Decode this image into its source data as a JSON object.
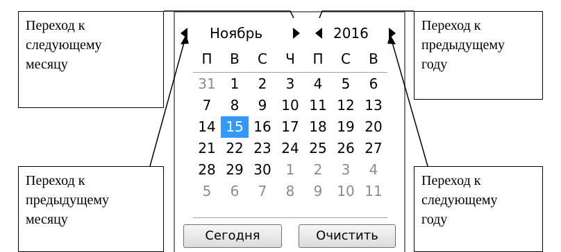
{
  "callouts": {
    "top_left": {
      "lines": [
        "Переход к",
        "следующему",
        "месяцу"
      ]
    },
    "top_right": {
      "lines": [
        "Переход к",
        "предыдущему",
        "году"
      ]
    },
    "bottom_left": {
      "lines": [
        "Переход к",
        "предыдущему",
        "месяцу"
      ]
    },
    "bottom_right": {
      "lines": [
        "Переход к",
        "следующему",
        "году"
      ]
    }
  },
  "calendar": {
    "month": "Ноябрь",
    "year": "2016",
    "weekdays": [
      "П",
      "В",
      "С",
      "Ч",
      "П",
      "С",
      "В"
    ],
    "selected_day": "15",
    "weeks": [
      [
        {
          "d": "31",
          "other": true
        },
        {
          "d": "1"
        },
        {
          "d": "2"
        },
        {
          "d": "3"
        },
        {
          "d": "4"
        },
        {
          "d": "5"
        },
        {
          "d": "6"
        }
      ],
      [
        {
          "d": "7"
        },
        {
          "d": "8"
        },
        {
          "d": "9"
        },
        {
          "d": "10"
        },
        {
          "d": "11"
        },
        {
          "d": "12"
        },
        {
          "d": "13"
        }
      ],
      [
        {
          "d": "14"
        },
        {
          "d": "15",
          "selected": true
        },
        {
          "d": "16"
        },
        {
          "d": "17"
        },
        {
          "d": "18"
        },
        {
          "d": "19"
        },
        {
          "d": "20"
        }
      ],
      [
        {
          "d": "21"
        },
        {
          "d": "22"
        },
        {
          "d": "23"
        },
        {
          "d": "24"
        },
        {
          "d": "25"
        },
        {
          "d": "26"
        },
        {
          "d": "27"
        }
      ],
      [
        {
          "d": "28"
        },
        {
          "d": "29"
        },
        {
          "d": "30"
        },
        {
          "d": "1",
          "other": true
        },
        {
          "d": "2",
          "other": true
        },
        {
          "d": "3",
          "other": true
        },
        {
          "d": "4",
          "other": true
        }
      ],
      [
        {
          "d": "5",
          "other": true
        },
        {
          "d": "6",
          "other": true
        },
        {
          "d": "7",
          "other": true
        },
        {
          "d": "8",
          "other": true
        },
        {
          "d": "9",
          "other": true
        },
        {
          "d": "10",
          "other": true
        },
        {
          "d": "11",
          "other": true
        }
      ]
    ],
    "today_label": "Сегодня",
    "clear_label": "Очистить",
    "selected_color": "#3399ff",
    "icons": {
      "prev_month": "triangle-left-icon",
      "next_month": "triangle-right-icon",
      "prev_year": "triangle-left-icon",
      "next_year": "triangle-right-icon"
    }
  }
}
